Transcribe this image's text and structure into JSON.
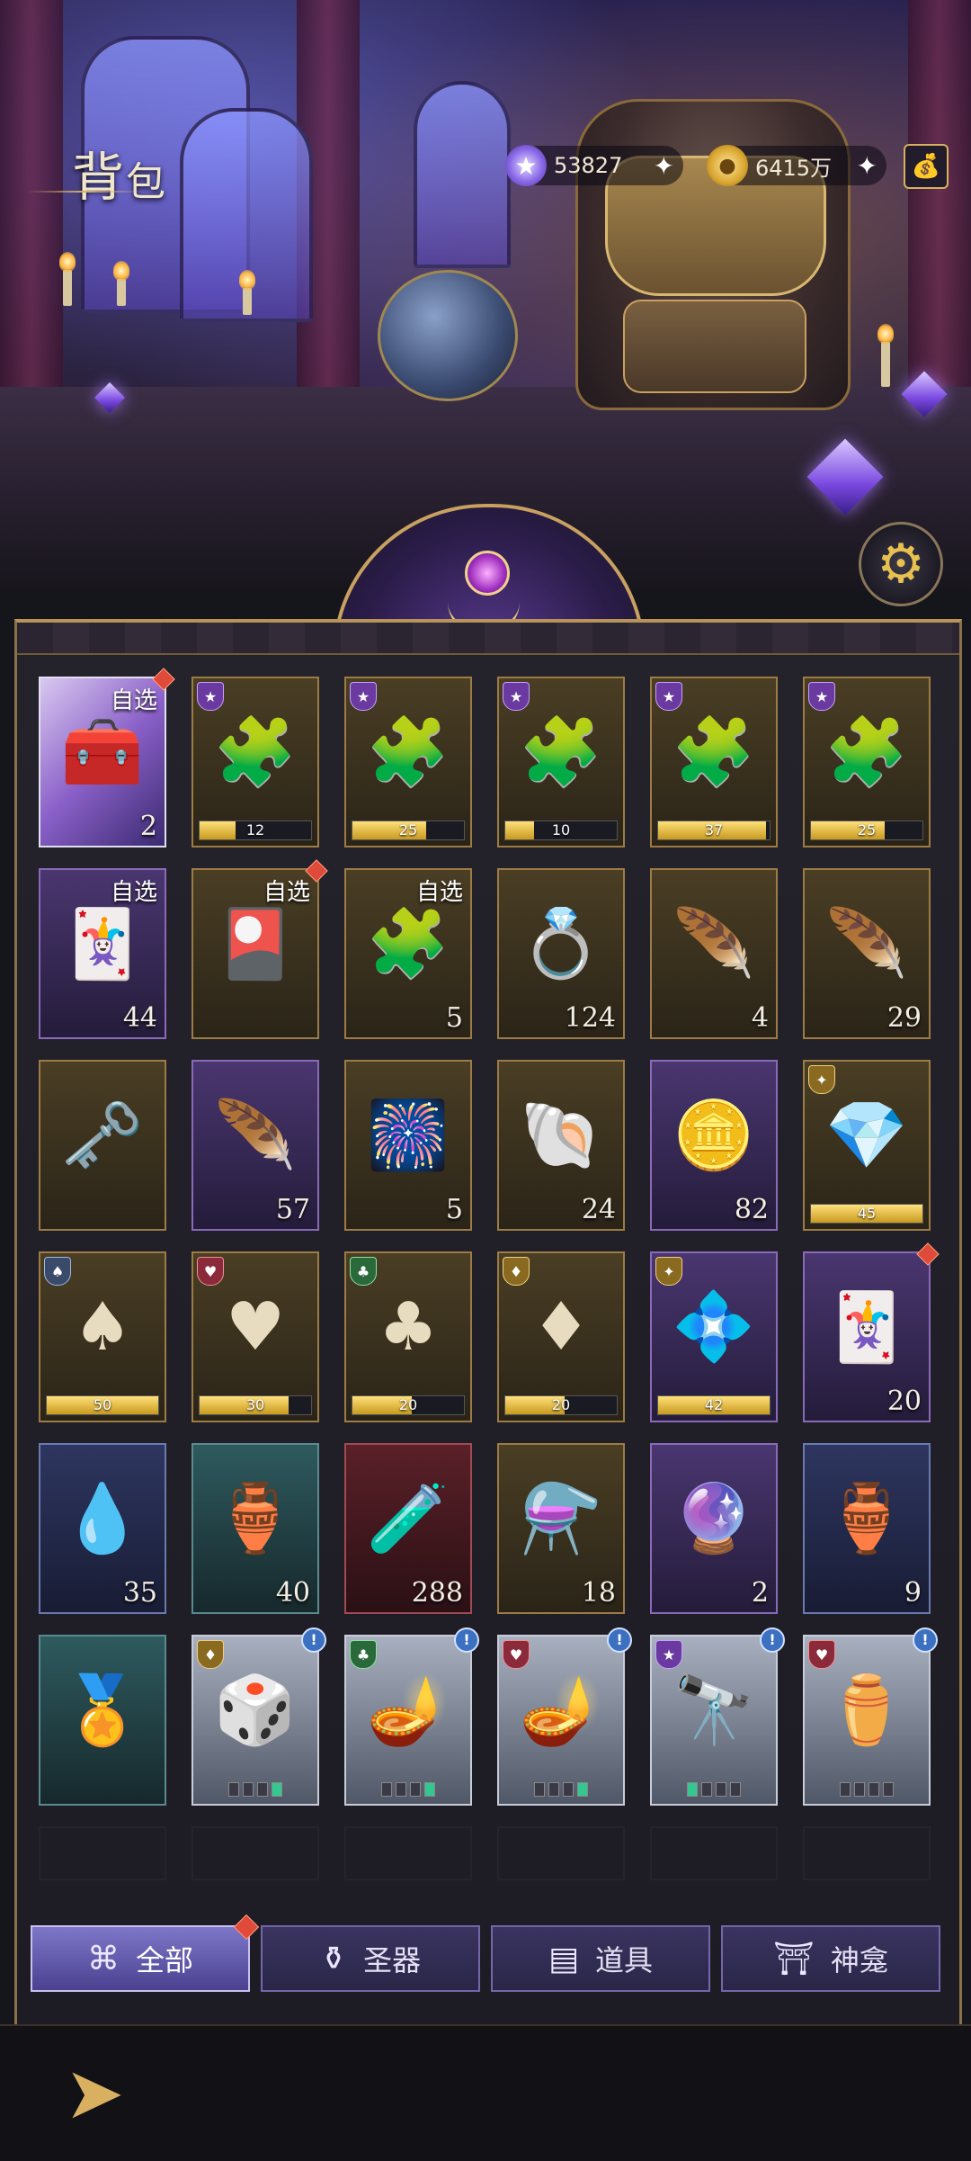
{
  "header": {
    "title_big": "背",
    "title_small": "包",
    "gems": "53827",
    "coins": "6415万"
  },
  "inventory": {
    "rows": [
      [
        {
          "style": "chest",
          "icon": "mystery-chest-icon",
          "art": "🧰",
          "count": "2",
          "pick": "自选",
          "dot": true
        },
        {
          "style": "gold",
          "icon": "portrait-puzzle-icon",
          "art": "🧩",
          "badge": "★",
          "progress": 0.32,
          "ptext": "12"
        },
        {
          "style": "gold",
          "icon": "portrait-puzzle-icon",
          "art": "🧩",
          "badge": "★",
          "progress": 0.66,
          "ptext": "25"
        },
        {
          "style": "gold",
          "icon": "portrait-puzzle-icon",
          "art": "🧩",
          "badge": "★",
          "progress": 0.26,
          "ptext": "10"
        },
        {
          "style": "gold",
          "icon": "portrait-puzzle-icon",
          "art": "🧩",
          "badge": "★",
          "progress": 0.97,
          "ptext": "37"
        },
        {
          "style": "gold",
          "icon": "portrait-puzzle-icon",
          "art": "🧩",
          "badge": "★",
          "progress": 0.66,
          "ptext": "25"
        }
      ],
      [
        {
          "style": "purple",
          "icon": "star-card-icon",
          "art": "🃏",
          "count": "44",
          "pick": "自选"
        },
        {
          "style": "gold",
          "icon": "rainbow-card-icon",
          "art": "🎴",
          "pick": "自选",
          "dot": true
        },
        {
          "style": "gold",
          "icon": "gold-puzzle-icon",
          "art": "🧩",
          "count": "5",
          "pick": "自选"
        },
        {
          "style": "gold",
          "icon": "crystal-ring-icon",
          "art": "💍",
          "count": "124"
        },
        {
          "style": "gold",
          "icon": "spade-feather-icon",
          "art": "🪶",
          "count": "4"
        },
        {
          "style": "gold",
          "icon": "golden-feather-icon",
          "art": "🪶",
          "count": "29"
        }
      ],
      [
        {
          "style": "gold",
          "icon": "gem-key-icon",
          "art": "🗝️"
        },
        {
          "style": "purple",
          "icon": "dark-feather-icon",
          "art": "🪶",
          "count": "57"
        },
        {
          "style": "gold",
          "icon": "fireworks-icon",
          "art": "🎆",
          "count": "5"
        },
        {
          "style": "gold",
          "icon": "seashell-icon",
          "art": "🐚",
          "count": "24"
        },
        {
          "style": "purple",
          "icon": "blue-token-icon",
          "art": "🪙",
          "count": "82"
        },
        {
          "style": "gold",
          "icon": "gold-crystal-icon",
          "art": "💎",
          "badge": "✦",
          "badgeStyle": "gold",
          "progress": 1.0,
          "ptext": "45"
        }
      ],
      [
        {
          "style": "gold",
          "icon": "spade-crystal-icon",
          "art": "♠",
          "badge": "♠",
          "badgeStyle": "slate",
          "progress": 1.0,
          "ptext": "50"
        },
        {
          "style": "gold",
          "icon": "heart-crystal-icon",
          "art": "♥",
          "badge": "♥",
          "badgeStyle": "red",
          "progress": 0.8,
          "ptext": "30"
        },
        {
          "style": "gold",
          "icon": "club-crystal-icon",
          "art": "♣",
          "badge": "♣",
          "badgeStyle": "green",
          "progress": 0.53,
          "ptext": "20"
        },
        {
          "style": "gold",
          "icon": "diamond-crystal-icon",
          "art": "♦",
          "badge": "♦",
          "badgeStyle": "gold",
          "progress": 0.53,
          "ptext": "20"
        },
        {
          "style": "purple",
          "icon": "purple-crystal-icon",
          "art": "💠",
          "badge": "✦",
          "badgeStyle": "gold",
          "progress": 1.0,
          "ptext": "42"
        },
        {
          "style": "purple",
          "icon": "star-card-icon",
          "art": "🃏",
          "count": "20",
          "dot": true
        }
      ],
      [
        {
          "style": "blue",
          "icon": "water-drop-gem-icon",
          "art": "💧",
          "count": "35"
        },
        {
          "style": "teal",
          "icon": "ornate-heart-amulet-icon",
          "art": "🏺",
          "count": "40"
        },
        {
          "style": "red",
          "icon": "red-potion-icon",
          "art": "🧪",
          "count": "288"
        },
        {
          "style": "gold",
          "icon": "amber-potion-icon",
          "art": "⚗️",
          "count": "18"
        },
        {
          "style": "purple",
          "icon": "magic-orb-icon",
          "art": "🔮",
          "count": "2"
        },
        {
          "style": "blue",
          "icon": "cracked-jar-icon",
          "art": "🏺",
          "count": "9"
        }
      ],
      [
        {
          "style": "teal",
          "icon": "bronze-medallion-icon",
          "art": "🏅"
        },
        {
          "style": "silver",
          "icon": "dice-artifact-icon",
          "art": "🎲",
          "badge": "♦",
          "badgeStyle": "gold",
          "info": true,
          "level": [
            false,
            false,
            false,
            true
          ]
        },
        {
          "style": "silver",
          "icon": "golden-lamp-icon",
          "art": "🪔",
          "badge": "♣",
          "badgeStyle": "green",
          "info": true,
          "level": [
            false,
            false,
            false,
            true
          ]
        },
        {
          "style": "silver",
          "icon": "golden-lamp-icon",
          "art": "🪔",
          "badge": "♥",
          "badgeStyle": "red",
          "info": true,
          "level": [
            false,
            false,
            false,
            true
          ]
        },
        {
          "style": "silver",
          "icon": "telescope-icon",
          "art": "🔭",
          "badge": "★",
          "badgeStyle": "",
          "info": true,
          "level": [
            true,
            false,
            false,
            false
          ]
        },
        {
          "style": "silver",
          "icon": "ornate-urn-icon",
          "art": "⚱️",
          "badge": "♥",
          "badgeStyle": "red",
          "info": true,
          "level": [
            false,
            false,
            false,
            false
          ]
        }
      ]
    ]
  },
  "tabs": [
    {
      "label": "全部",
      "icon": "grid-icon",
      "glyph": "⌘",
      "active": true,
      "dot": true
    },
    {
      "label": "圣器",
      "icon": "chalice-icon",
      "glyph": "⚱",
      "active": false
    },
    {
      "label": "道具",
      "icon": "gold-bars-icon",
      "glyph": "▤",
      "active": false
    },
    {
      "label": "神龛",
      "icon": "shrine-icon",
      "glyph": "⛩",
      "active": false
    }
  ]
}
